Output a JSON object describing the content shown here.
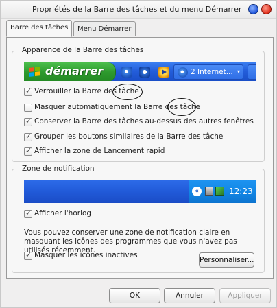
{
  "window": {
    "title": "Propriétés de la Barre des tâches et du menu Démarrer"
  },
  "tabs": [
    {
      "label": "Barre des tâches",
      "active": true
    },
    {
      "label": "Menu Démarrer",
      "active": false
    }
  ],
  "appearance": {
    "legend": "Apparence de la Barre des tâches",
    "preview": {
      "start_label": "démarrer",
      "task_button": "2 Internet...",
      "task_arrow": "▾"
    },
    "options": [
      {
        "label": "Verrouiller la Barre des tâche",
        "checked": true
      },
      {
        "label": "Masquer automatiquement la Barre des tâche",
        "checked": false
      },
      {
        "label": "Conserver la Barre des tâches au-dessus des autres fenêtres",
        "checked": true
      },
      {
        "label": "Grouper les boutons similaires de la Barre des tâche",
        "checked": true
      },
      {
        "label": "Afficher la zone de Lancement rapid",
        "checked": true
      }
    ]
  },
  "notification": {
    "legend": "Zone de notification",
    "preview": {
      "clock": "12:23",
      "chevron": "«"
    },
    "show_clock": {
      "label": "Afficher l'horlog",
      "checked": true
    },
    "description": "Vous pouvez conserver une zone de notification claire en masquant les icônes des programmes que vous n'avez pas utilisés récemment.",
    "hide_inactive": {
      "label": "Masquer les icônes inactives",
      "checked": true
    },
    "customize_label": "Personnaliser..."
  },
  "buttons": {
    "ok": "OK",
    "cancel": "Annuler",
    "apply": "Appliquer"
  }
}
